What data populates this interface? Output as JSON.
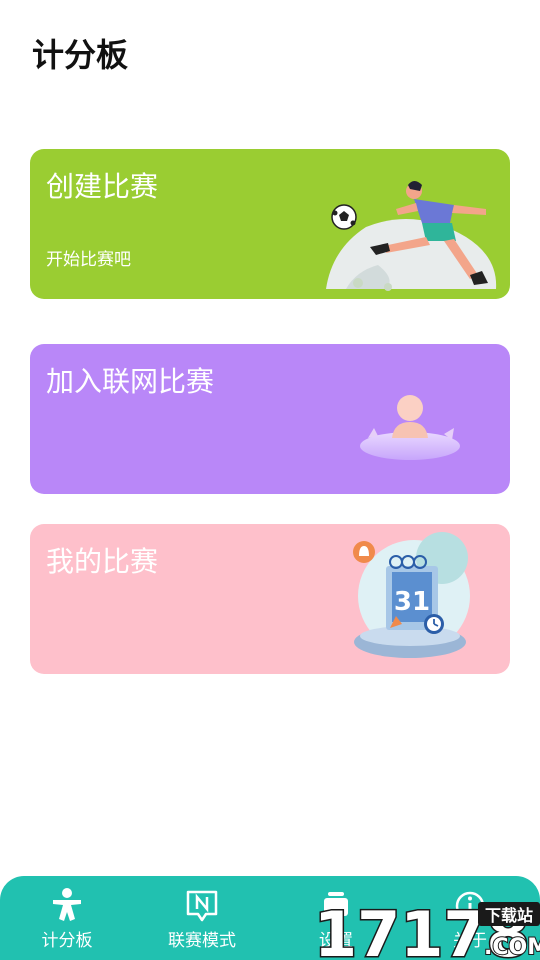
{
  "page": {
    "title": "计分板"
  },
  "cards": [
    {
      "title": "创建比赛",
      "subtitle": "开始比赛吧",
      "color": "#9acd32",
      "illustration": "soccer-player-illustration"
    },
    {
      "title": "加入联网比赛",
      "color": "#b987f8",
      "illustration": "network-person-illustration"
    },
    {
      "title": "我的比赛",
      "color": "#fec0cb",
      "illustration": "calendar-illustration",
      "calendar_day": "31"
    }
  ],
  "tabbar": {
    "background": "#21c1b0",
    "tabs": [
      {
        "label": "计分板",
        "icon": "person-icon"
      },
      {
        "label": "联赛模式",
        "icon": "n-badge-icon"
      },
      {
        "label": "设置",
        "icon": "settings-icon"
      },
      {
        "label": "关于",
        "icon": "info-icon"
      }
    ]
  },
  "watermark": {
    "number": "17178",
    "tag": "下载站",
    "suffix": ".COM"
  }
}
